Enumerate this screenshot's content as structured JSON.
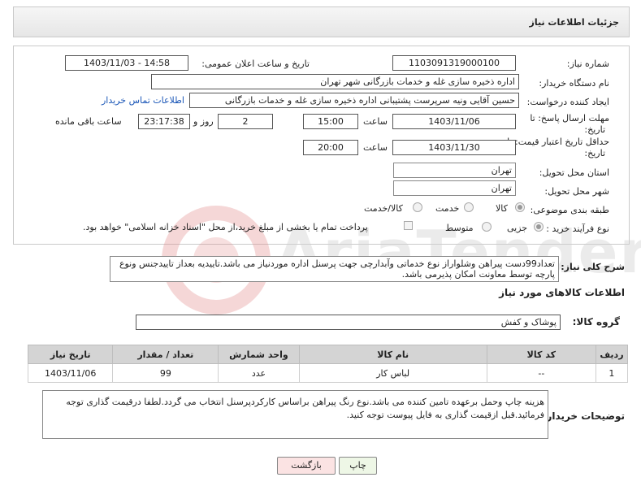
{
  "header": {
    "title": "جزئیات اطلاعات نیاز"
  },
  "form": {
    "need_number_label": "شماره نیاز:",
    "need_number": "1103091319000100",
    "announce_label": "تاریخ و ساعت اعلان عمومی:",
    "announce_value": "1403/11/03 - 14:58",
    "buyer_org_label": "نام دستگاه خریدار:",
    "buyer_org": "اداره ذخیره سازی غله و خدمات بازرگانی شهر تهران",
    "creator_label": "ایجاد کننده درخواست:",
    "creator": "حسین آقایی ونیه سرپرست پشتیبانی اداره ذخیره سازی غله و خدمات بازرگانی",
    "buyer_contact_link": "اطلاعات تماس خریدار",
    "deadline_label": "مهلت ارسال پاسخ: تا",
    "deadline_label2": "تاریخ:",
    "deadline_date": "1403/11/06",
    "time_label": "ساعت",
    "deadline_time": "15:00",
    "days_value": "2",
    "days_label": "روز و",
    "remaining_time": "23:17:38",
    "remaining_label": "ساعت باقی مانده",
    "validity_label": "حداقل تاریخ اعتبار قیمت: تا",
    "validity_label2": "تاریخ:",
    "validity_date": "1403/11/30",
    "validity_time": "20:00",
    "province_label": "استان محل تحویل:",
    "province": "تهران",
    "city_label": "شهر محل تحویل:",
    "city": "تهران",
    "category_label": "طبقه بندی موضوعی:",
    "category_options": [
      "کالا",
      "خدمت",
      "کالا/خدمت"
    ],
    "purchase_type_label": "نوع فرآیند خرید :",
    "purchase_type_options": [
      "جزیی",
      "متوسط"
    ],
    "payment_note": "پرداخت تمام یا بخشی از مبلغ خرید،از محل \"اسناد خزانه اسلامی\" خواهد بود."
  },
  "summary": {
    "label": "شرح کلی نیاز:",
    "text": "تعداد99دست پیراهن وشلواراز نوع خدماتی وآبدارچی جهت پرسنل اداره موردنیاز می باشد.تاییدیه بعداز تاییدجنس ونوع پارچه توسط معاونت امکان پذیرمی باشد."
  },
  "goods": {
    "section_title": "اطلاعات کالاهای مورد نیاز",
    "group_label": "گروه کالا:",
    "group_value": "پوشاک و کفش",
    "columns": [
      "ردیف",
      "کد کالا",
      "نام کالا",
      "واحد شمارش",
      "تعداد / مقدار",
      "تاریخ نیاز"
    ],
    "rows": [
      {
        "row": "1",
        "code": "--",
        "name": "لباس کار",
        "unit": "عدد",
        "qty": "99",
        "date": "1403/11/06"
      }
    ]
  },
  "buyer_notes": {
    "label": "توضیحات خریدار:",
    "text": "هزینه چاپ وحمل برعهده تامین کننده می باشد.نوع رنگ پیراهن براساس کارکردپرسنل انتخاب می گردد.لطفا درقیمت گذاری توجه فرمائید.قبل ازقیمت گذاری به فایل پیوست توجه کنید."
  },
  "buttons": {
    "print": "چاپ",
    "back": "بازگشت"
  },
  "watermark": {
    "text": "AriaTender.net"
  },
  "colors": {
    "link": "#1a56b7",
    "header_bg": "#e6e6e6",
    "table_header": "#d4d4d4",
    "back_button_bg": "#fbe3e3",
    "print_button_bg": "#eef7e6"
  }
}
